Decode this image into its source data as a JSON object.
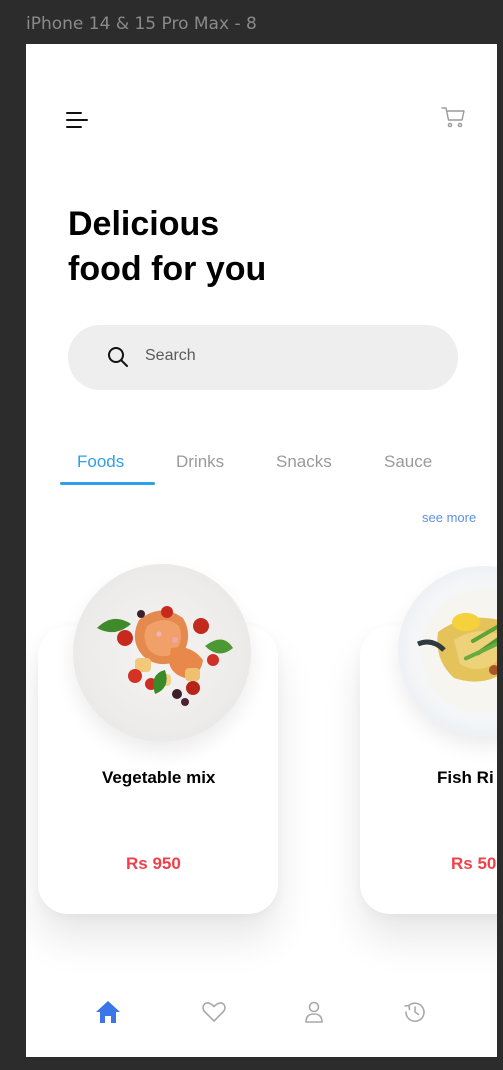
{
  "frame_label": "iPhone 14 & 15 Pro Max - 8",
  "header": {
    "menu_icon": "hamburger-icon",
    "cart_icon": "cart-icon"
  },
  "headline": {
    "line1": "Delicious",
    "line2": "food for you"
  },
  "search": {
    "placeholder": "Search",
    "icon": "search-icon"
  },
  "tabs": [
    {
      "label": "Foods",
      "active": true
    },
    {
      "label": "Drinks",
      "active": false
    },
    {
      "label": "Snacks",
      "active": false
    },
    {
      "label": "Sauce",
      "active": false
    }
  ],
  "see_more": "see more",
  "products": [
    {
      "name": "Vegetable mix",
      "price": "Rs 950"
    },
    {
      "name": "Fish Ri",
      "price": "Rs 50"
    }
  ],
  "bottom_nav": [
    {
      "icon": "home-icon",
      "active": true
    },
    {
      "icon": "heart-icon",
      "active": false
    },
    {
      "icon": "user-icon",
      "active": false
    },
    {
      "icon": "history-icon",
      "active": false
    }
  ],
  "colors": {
    "accent": "#2f9fe8",
    "price": "#f0414a",
    "nav_active": "#3b76e8",
    "nav_inactive": "#a9a9a9",
    "search_bg": "#efeeee"
  }
}
